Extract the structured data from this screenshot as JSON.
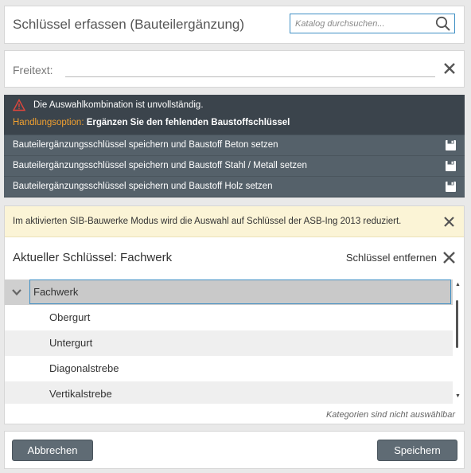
{
  "header": {
    "title": "Schlüssel erfassen (Bauteilergänzung)",
    "search_placeholder": "Katalog durchsuchen..."
  },
  "freetext": {
    "label": "Freitext:",
    "value": ""
  },
  "warning": {
    "message": "Die Auswahlkombination ist unvollständig.",
    "option_label": "Handlungsoption:",
    "option_text": "Ergänzen Sie den fehlenden Baustoffschlüssel",
    "accent_color": "#f0a030",
    "actions": [
      {
        "label": "Bauteilergänzungsschlüssel speichern und Baustoff Beton setzen"
      },
      {
        "label": "Bauteilergänzungsschlüssel speichern und Baustoff Stahl / Metall setzen"
      },
      {
        "label": "Bauteilergänzungsschlüssel speichern und Baustoff Holz setzen"
      }
    ]
  },
  "info": {
    "text": "Im aktivierten SIB-Bauwerke Modus wird die Auswahl auf Schlüssel der ASB-Ing 2013 reduziert."
  },
  "current_key": {
    "title": "Aktueller Schlüssel: Fachwerk",
    "remove_label": "Schlüssel entfernen"
  },
  "tree": {
    "selected": "Fachwerk",
    "items": [
      {
        "label": "Obergurt"
      },
      {
        "label": "Untergurt"
      },
      {
        "label": "Diagonalstrebe"
      },
      {
        "label": "Vertikalstrebe"
      }
    ]
  },
  "note": "Kategorien sind nicht auswählbar",
  "footer": {
    "cancel_label": "Abbrechen",
    "save_label": "Speichern"
  }
}
